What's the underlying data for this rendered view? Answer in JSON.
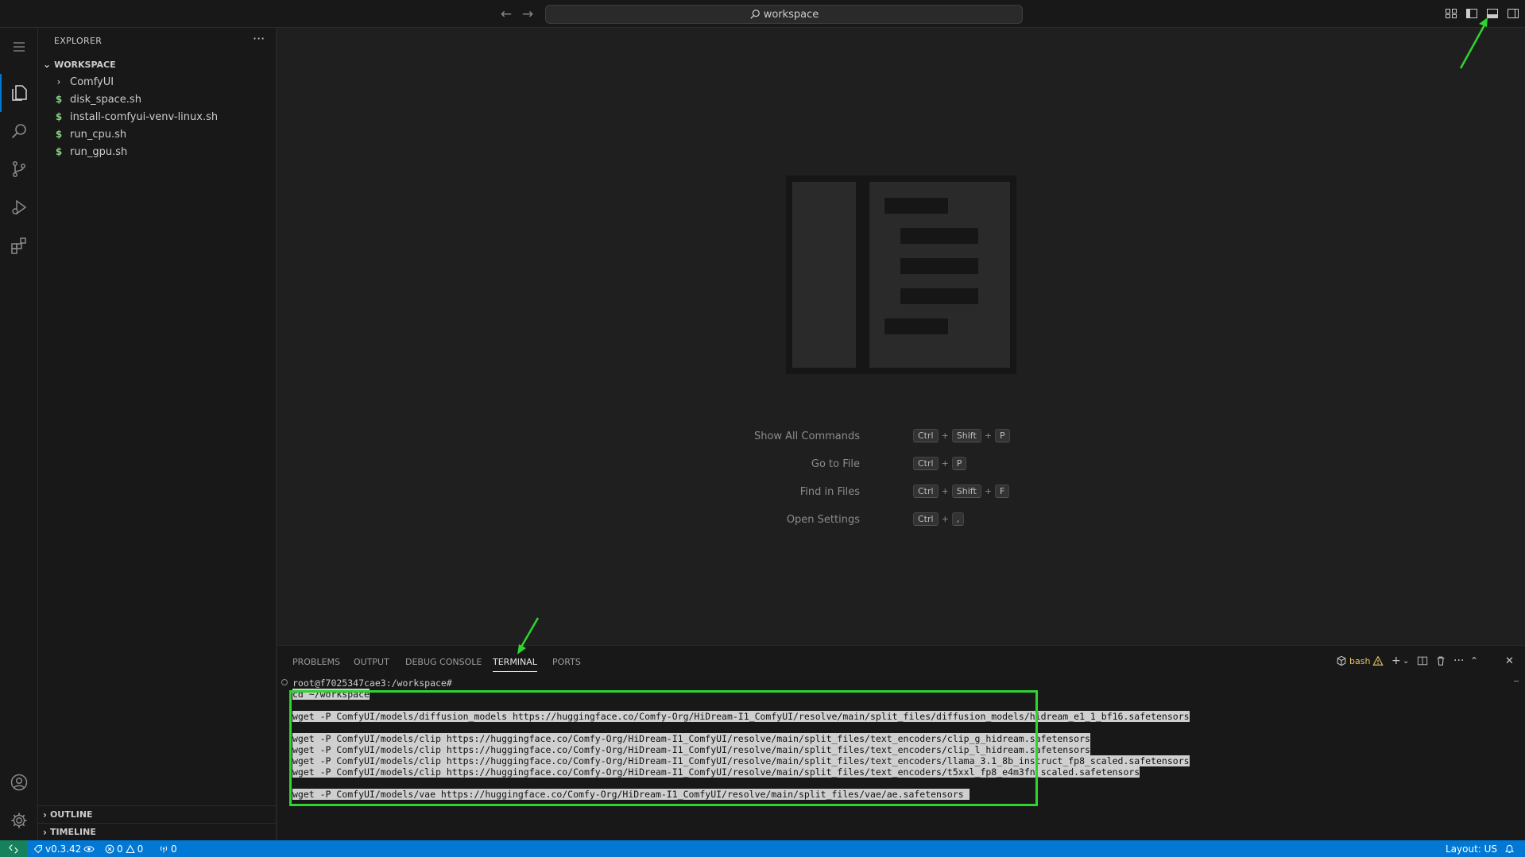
{
  "titlebar": {
    "search_text": "workspace",
    "back_icon": "arrow-left-icon",
    "forward_icon": "arrow-right-icon"
  },
  "activity": {
    "items": [
      "files-icon",
      "search-icon",
      "source-control-icon",
      "run-debug-icon",
      "extensions-icon"
    ],
    "bottom": [
      "account-icon",
      "settings-gear-icon"
    ]
  },
  "sidebar": {
    "title": "EXPLORER",
    "more": "···",
    "workspace_label": "WORKSPACE",
    "files": [
      {
        "name": "ComfyUI",
        "kind": "folder"
      },
      {
        "name": "disk_space.sh",
        "kind": "shell"
      },
      {
        "name": "install-comfyui-venv-linux.sh",
        "kind": "shell"
      },
      {
        "name": "run_cpu.sh",
        "kind": "shell"
      },
      {
        "name": "run_gpu.sh",
        "kind": "shell"
      }
    ],
    "outline_label": "OUTLINE",
    "timeline_label": "TIMELINE"
  },
  "welcome": {
    "shortcuts": [
      {
        "label": "Show All Commands",
        "keys": [
          "Ctrl",
          "Shift",
          "P"
        ]
      },
      {
        "label": "Go to File",
        "keys": [
          "Ctrl",
          "P"
        ]
      },
      {
        "label": "Find in Files",
        "keys": [
          "Ctrl",
          "Shift",
          "F"
        ]
      },
      {
        "label": "Open Settings",
        "keys": [
          "Ctrl",
          ","
        ]
      }
    ],
    "plus": "+"
  },
  "panel": {
    "tabs": [
      "PROBLEMS",
      "OUTPUT",
      "DEBUG CONSOLE",
      "TERMINAL",
      "PORTS"
    ],
    "active_tab": "TERMINAL",
    "terminal_name": "bash",
    "prompt": "root@f7025347cae3:/workspace#",
    "lines": [
      "cd ~/workspace",
      "",
      "wget -P ComfyUI/models/diffusion_models https://huggingface.co/Comfy-Org/HiDream-I1_ComfyUI/resolve/main/split_files/diffusion_models/hidream_e1_1_bf16.safetensors",
      "",
      "wget -P ComfyUI/models/clip https://huggingface.co/Comfy-Org/HiDream-I1_ComfyUI/resolve/main/split_files/text_encoders/clip_g_hidream.safetensors",
      "wget -P ComfyUI/models/clip https://huggingface.co/Comfy-Org/HiDream-I1_ComfyUI/resolve/main/split_files/text_encoders/clip_l_hidream.safetensors",
      "wget -P ComfyUI/models/clip https://huggingface.co/Comfy-Org/HiDream-I1_ComfyUI/resolve/main/split_files/text_encoders/llama_3.1_8b_instruct_fp8_scaled.safetensors",
      "wget -P ComfyUI/models/clip https://huggingface.co/Comfy-Org/HiDream-I1_ComfyUI/resolve/main/split_files/text_encoders/t5xxl_fp8_e4m3fn_scaled.safetensors",
      "",
      "wget -P ComfyUI/models/vae https://huggingface.co/Comfy-Org/HiDream-I1_ComfyUI/resolve/main/split_files/vae/ae.safetensors "
    ]
  },
  "statusbar": {
    "version": "v0.3.42",
    "errors": "0",
    "warnings": "0",
    "ports": "0",
    "layout": "Layout: US"
  },
  "colors": {
    "accent": "#0078d4",
    "remote": "#16825d",
    "annotation": "#2fd42f"
  }
}
